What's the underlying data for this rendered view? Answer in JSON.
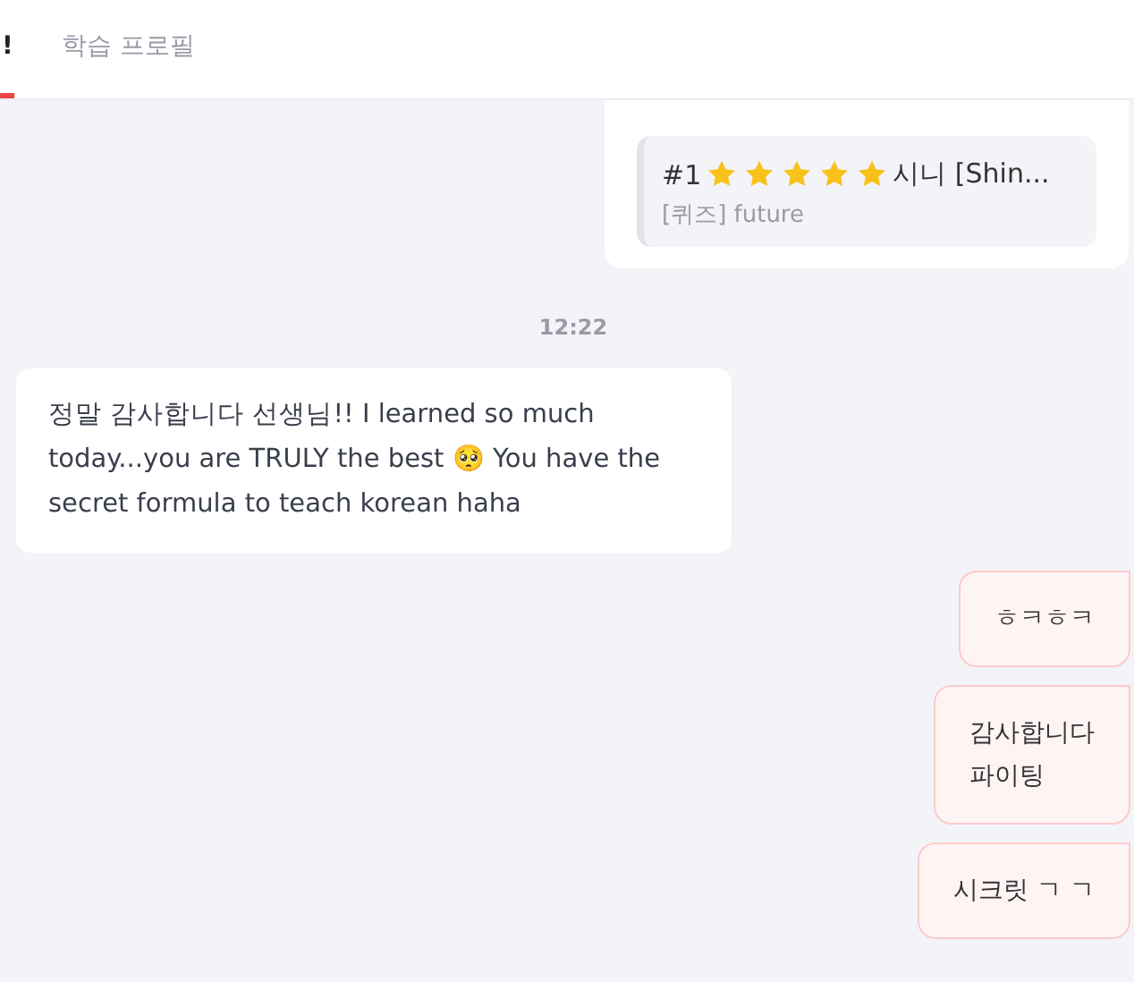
{
  "tabs": [
    {
      "label": "!",
      "selected": true
    },
    {
      "label": "학습 프로필",
      "selected": false
    }
  ],
  "quiz_card": {
    "number": "#1",
    "stars": 5,
    "title": "시니 [Shin...",
    "subtitle": "[퀴즈] future"
  },
  "time": "12:22",
  "messages": [
    {
      "kind": "incoming",
      "text": "정말 감사합니다 선생님!! I learned so much today...you are TRULY the best 🥺 You have the secret formula to teach korean haha"
    },
    {
      "kind": "outgoing",
      "text": "ㅎㅋㅎㅋ"
    },
    {
      "kind": "outgoing",
      "text": "감사합니다\n파이팅"
    },
    {
      "kind": "outgoing",
      "text": "시크릿 ㄱ ㄱ"
    }
  ]
}
